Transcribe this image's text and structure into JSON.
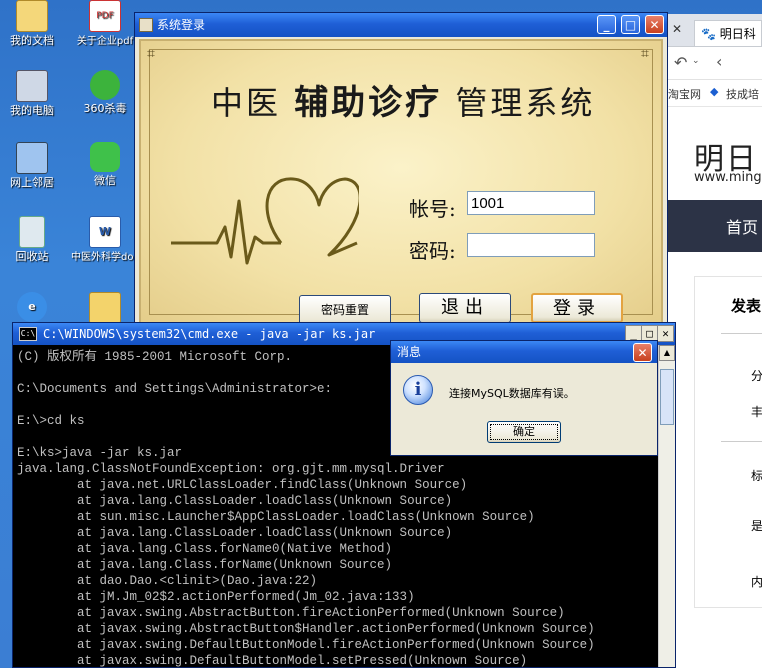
{
  "desktop": {
    "icons": [
      {
        "label": "我的文档",
        "icon": "my-documents-icon"
      },
      {
        "label": "关于企业pdf",
        "icon": "pdf-file-icon"
      },
      {
        "label": "我的电脑",
        "icon": "my-computer-icon"
      },
      {
        "label": "360杀毒",
        "icon": "antivirus-icon"
      },
      {
        "label": "网上邻居",
        "icon": "network-icon"
      },
      {
        "label": "微信",
        "icon": "wechat-icon"
      },
      {
        "label": "回收站",
        "icon": "recycle-bin-icon"
      },
      {
        "label": "中医外科学doc",
        "icon": "word-doc-icon"
      },
      {
        "label": "",
        "icon": "ie-icon"
      },
      {
        "label": "",
        "icon": "folder-icon"
      }
    ]
  },
  "browser": {
    "tab_label": "明日科",
    "bookmark1": "淘宝网",
    "bookmark2": "技成培",
    "site_logo": "明日",
    "site_url": "www.ming",
    "nav_home": "首页",
    "side_title": "发表",
    "side_items": [
      "分",
      "丰",
      "标",
      "是",
      "内"
    ]
  },
  "login": {
    "title": "系统登录",
    "heading_left": "中医",
    "heading_bold": "辅助诊疗",
    "heading_right": "管理系统",
    "account_label": "帐号:",
    "account_value": "1001",
    "password_label": "密码:",
    "password_value": "",
    "reset_button": "密码重置",
    "exit_button": "退出",
    "login_button": "登录"
  },
  "cmd": {
    "title": "C:\\WINDOWS\\system32\\cmd.exe - java -jar ks.jar",
    "lines": [
      "(C) 版权所有 1985-2001 Microsoft Corp.",
      "",
      "C:\\Documents and Settings\\Administrator>e:",
      "",
      "E:\\>cd ks",
      "",
      "E:\\ks>java -jar ks.jar",
      "java.lang.ClassNotFoundException: org.gjt.mm.mysql.Driver",
      "        at java.net.URLClassLoader.findClass(Unknown Source)",
      "        at java.lang.ClassLoader.loadClass(Unknown Source)",
      "        at sun.misc.Launcher$AppClassLoader.loadClass(Unknown Source)",
      "        at java.lang.ClassLoader.loadClass(Unknown Source)",
      "        at java.lang.Class.forName0(Native Method)",
      "        at java.lang.Class.forName(Unknown Source)",
      "        at dao.Dao.<clinit>(Dao.java:22)",
      "        at jM.Jm_02$2.actionPerformed(Jm_02.java:133)",
      "        at javax.swing.AbstractButton.fireActionPerformed(Unknown Source)",
      "        at javax.swing.AbstractButton$Handler.actionPerformed(Unknown Source)",
      "        at javax.swing.DefaultButtonModel.fireActionPerformed(Unknown Source)",
      "        at javax.swing.DefaultButtonModel.setPressed(Unknown Source)"
    ]
  },
  "dialog": {
    "title": "消息",
    "message": "连接MySQL数据库有误。",
    "ok_button": "确定"
  }
}
